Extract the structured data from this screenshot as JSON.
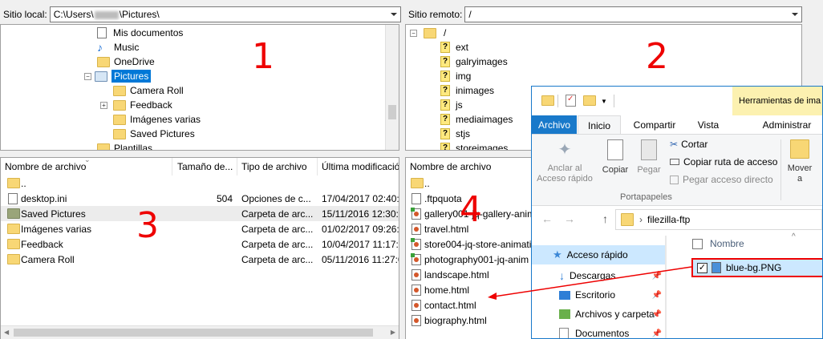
{
  "local": {
    "path_label": "Sitio local:",
    "path_prefix": "C:\\Users\\",
    "path_suffix": "\\Pictures\\",
    "tree": [
      {
        "label": "Mis documentos",
        "icon": "document-folder-icon"
      },
      {
        "label": "Music",
        "icon": "music-icon"
      },
      {
        "label": "OneDrive",
        "icon": "folder-icon"
      },
      {
        "label": "Pictures",
        "icon": "pictures-folder-icon",
        "selected": true
      },
      {
        "label": "Camera Roll",
        "icon": "folder-icon"
      },
      {
        "label": "Feedback",
        "icon": "folder-icon"
      },
      {
        "label": "Imágenes varias",
        "icon": "folder-icon"
      },
      {
        "label": "Saved Pictures",
        "icon": "folder-icon"
      },
      {
        "label": "Plantillas",
        "icon": "folder-icon"
      }
    ],
    "columns": [
      "Nombre de archivo",
      "Tamaño de...",
      "Tipo de archivo",
      "Última modificació"
    ],
    "files": [
      {
        "name": "..",
        "size": "",
        "type": "",
        "date": "",
        "icon": "folder-icon"
      },
      {
        "name": "desktop.ini",
        "size": "504",
        "type": "Opciones de c...",
        "date": "17/04/2017 02:40:2",
        "icon": "file-icon"
      },
      {
        "name": "Saved Pictures",
        "size": "",
        "type": "Carpeta de arc...",
        "date": "15/11/2016 12:30:2",
        "icon": "saved-folder-icon"
      },
      {
        "name": "Imágenes varias",
        "size": "",
        "type": "Carpeta de arc...",
        "date": "01/02/2017 09:26:5",
        "icon": "folder-icon"
      },
      {
        "name": "Feedback",
        "size": "",
        "type": "Carpeta de arc...",
        "date": "10/04/2017 11:17:3",
        "icon": "folder-icon"
      },
      {
        "name": "Camera Roll",
        "size": "",
        "type": "Carpeta de arc...",
        "date": "05/11/2016 11:27:0",
        "icon": "folder-icon"
      }
    ]
  },
  "remote": {
    "path_label": "Sitio remoto:",
    "path": "/",
    "tree": [
      {
        "label": "/",
        "icon": "folder-icon"
      },
      {
        "label": "ext",
        "icon": "unknown-folder-icon"
      },
      {
        "label": "galryimages",
        "icon": "unknown-folder-icon"
      },
      {
        "label": "img",
        "icon": "unknown-folder-icon"
      },
      {
        "label": "inimages",
        "icon": "unknown-folder-icon"
      },
      {
        "label": "js",
        "icon": "unknown-folder-icon"
      },
      {
        "label": "mediaimages",
        "icon": "unknown-folder-icon"
      },
      {
        "label": "stjs",
        "icon": "unknown-folder-icon"
      },
      {
        "label": "storeimages",
        "icon": "unknown-folder-icon"
      }
    ],
    "column": "Nombre de archivo",
    "files": [
      {
        "name": "..",
        "icon": "folder-icon"
      },
      {
        "name": ".ftpquota",
        "icon": "file-icon"
      },
      {
        "name": "gallery001-jq-gallery-anim",
        "icon": "html-file-icon"
      },
      {
        "name": "travel.html",
        "icon": "html-file-icon"
      },
      {
        "name": "store004-jq-store-animati",
        "icon": "html-file-icon"
      },
      {
        "name": "photography001-jq-anim",
        "icon": "html-file-icon"
      },
      {
        "name": "landscape.html",
        "icon": "html-file-icon"
      },
      {
        "name": "home.html",
        "icon": "html-file-icon"
      },
      {
        "name": "contact.html",
        "icon": "html-file-icon"
      },
      {
        "name": "biography.html",
        "icon": "html-file-icon"
      }
    ]
  },
  "annotations": {
    "n1": "1",
    "n2": "2",
    "n3": "3",
    "n4": "4"
  },
  "explorer": {
    "contextual_tab": "Herramientas de ima",
    "tabs": [
      "Archivo",
      "Inicio",
      "Compartir",
      "Vista",
      "Administrar"
    ],
    "ribbon": {
      "pin": "Anclar al\nAcceso rápido",
      "copy": "Copiar",
      "paste": "Pegar",
      "cut": "Cortar",
      "copy_path": "Copiar ruta de acceso",
      "paste_shortcut": "Pegar acceso directo",
      "move": "Mover\na",
      "group": "Portapapeles"
    },
    "address": "filezilla-ftp",
    "nav": [
      {
        "label": "Acceso rápido",
        "icon": "star-icon"
      },
      {
        "label": "Descargas",
        "icon": "download-icon"
      },
      {
        "label": "Escritorio",
        "icon": "desktop-icon"
      },
      {
        "label": "Archivos y carpeta",
        "icon": "folder-icon"
      },
      {
        "label": "Documentos",
        "icon": "documents-icon"
      }
    ],
    "column": "Nombre",
    "file": "blue-bg.PNG",
    "accent": "#1979ca"
  }
}
